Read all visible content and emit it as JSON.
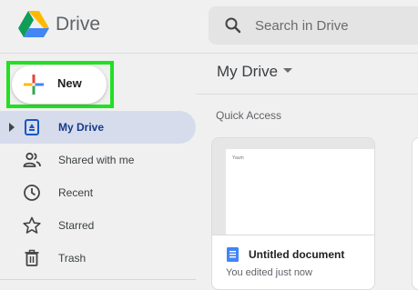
{
  "header": {
    "app_title": "Drive",
    "logo_icon": "google-drive-logo",
    "search": {
      "placeholder": "Search in Drive",
      "value": "",
      "icon": "search-icon"
    }
  },
  "sidebar": {
    "new_button": {
      "label": "New",
      "icon": "plus-icon",
      "highlight_color": "#22e022"
    },
    "items": [
      {
        "label": "My Drive",
        "icon": "my-drive-icon",
        "active": true,
        "expandable": true
      },
      {
        "label": "Shared with me",
        "icon": "people-icon",
        "active": false
      },
      {
        "label": "Recent",
        "icon": "clock-icon",
        "active": false
      },
      {
        "label": "Starred",
        "icon": "star-icon",
        "active": false
      },
      {
        "label": "Trash",
        "icon": "trash-icon",
        "active": false
      }
    ]
  },
  "main": {
    "title": "My Drive",
    "section_heading": "Quick Access",
    "files": [
      {
        "name": "Untitled document",
        "meta": "You edited just now",
        "thumbnail_text": "Yaum",
        "icon": "google-docs-icon"
      }
    ]
  },
  "colors": {
    "accent_blue": "#4285f4",
    "active_nav_bg": "#d6dceb",
    "active_nav_text": "#173a8a",
    "background": "#f0f0f0"
  }
}
